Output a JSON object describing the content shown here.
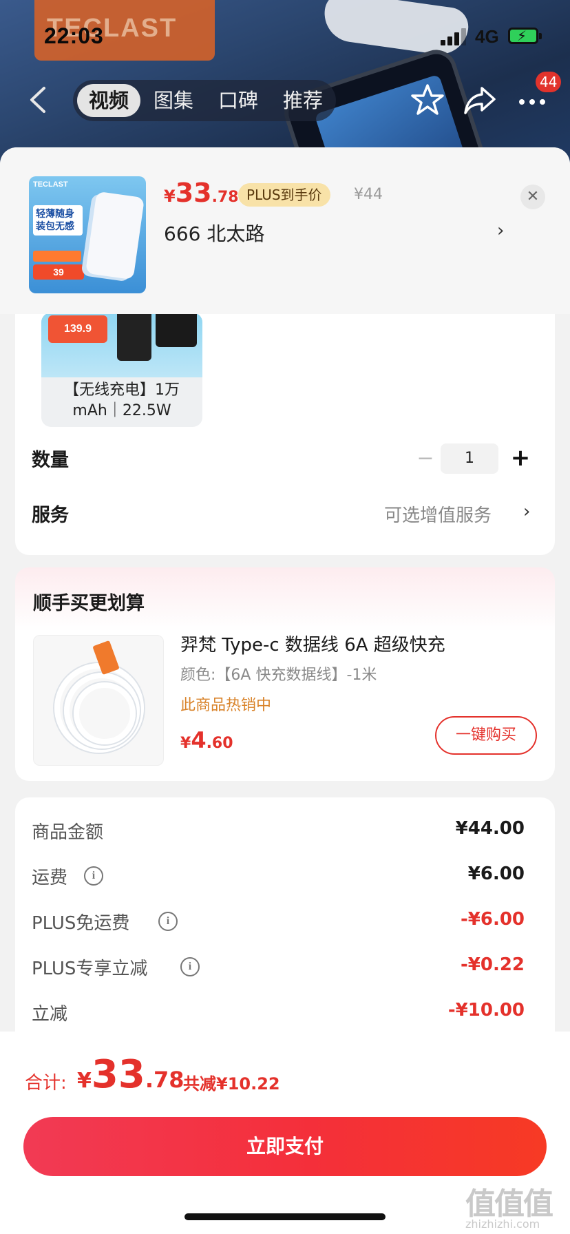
{
  "status_bar": {
    "time": "22:03",
    "network": "4G"
  },
  "banner": {
    "brand_text": "TECLAST"
  },
  "nav": {
    "tabs": [
      {
        "label": "视频",
        "active": true
      },
      {
        "label": "图集",
        "active": false
      },
      {
        "label": "口碑",
        "active": false
      },
      {
        "label": "推荐",
        "active": false
      }
    ],
    "message_count": "44"
  },
  "sheet_header": {
    "thumb": {
      "brand": "TECLAST",
      "text": "轻薄随身 装包无感",
      "price": "39"
    },
    "price": {
      "currency": "¥",
      "integer": "33",
      "decimal": ".78"
    },
    "plus_tag": "PLUS到手价",
    "original_price": "¥44",
    "address": "666  北太路"
  },
  "spec": {
    "variant": {
      "badge_price": "139.9",
      "label": "【无线充电】1万mAh｜22.5W"
    },
    "quantity_label": "数量",
    "quantity_value": "1",
    "service_label": "服务",
    "service_value": "可选增值服务"
  },
  "upsell": {
    "title": "顺手买更划算",
    "item": {
      "name": "羿梵 Type-c 数据线 6A 超级快充",
      "spec": "颜色:【6A 快充数据线】-1米",
      "hot": "此商品热销中",
      "price": {
        "currency": "¥",
        "integer": "4",
        "decimal": ".60"
      },
      "buy_label": "一键购买"
    }
  },
  "summary": {
    "rows": [
      {
        "label": "商品金额",
        "value": "¥44.00",
        "info": false,
        "red": false
      },
      {
        "label": "运费",
        "value": "¥6.00",
        "info": true,
        "red": false
      },
      {
        "label": "PLUS免运费",
        "value": "-¥6.00",
        "info": true,
        "red": true
      },
      {
        "label": "PLUS专享立减",
        "value": "-¥0.22",
        "info": true,
        "red": true
      },
      {
        "label": "立减",
        "value": "-¥10.00",
        "info": false,
        "red": true
      }
    ]
  },
  "bottom": {
    "total_label": "合计:",
    "total": {
      "currency": "¥",
      "integer": "33",
      "decimal": ".78"
    },
    "saved": "共减¥10.22",
    "pay_label": "立即支付"
  },
  "watermark": {
    "main": "值值值",
    "sub": "zhizhizhi.com"
  },
  "colors": {
    "accent_red": "#e4312b",
    "hot_orange": "#d9832a",
    "plus_gold": "#f8e2a8"
  }
}
